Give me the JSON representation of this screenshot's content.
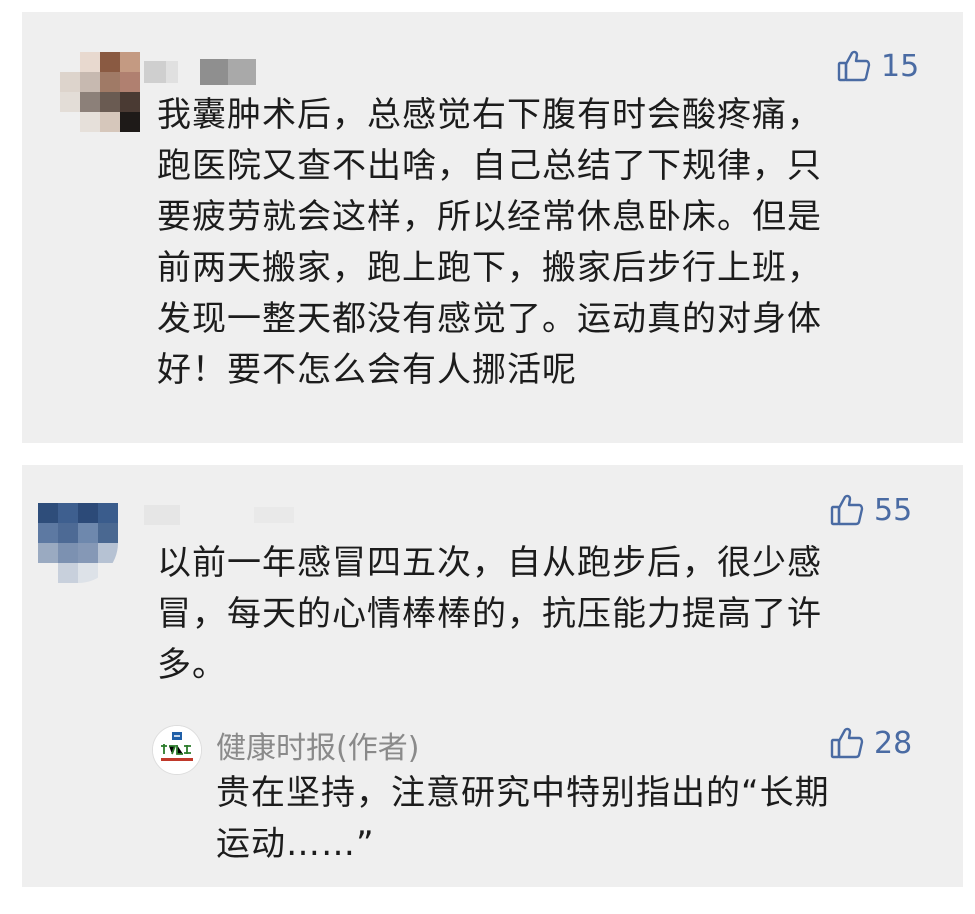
{
  "comments": [
    {
      "likes": "15",
      "lines": [
        "我囊肿术后，总感觉右下腹有时会酸疼痛，",
        "跑医院又查不出啥，自己总结了下规律，只",
        "要疲劳就会这样，所以经常休息卧床。但是",
        "前两天搬家，跑上跑下，搬家后步行上班，",
        "发现一整天都没有感觉了。运动真的对身体",
        "好！要不怎么会有人挪活呢"
      ]
    },
    {
      "likes": "55",
      "lines": [
        "以前一年感冒四五次，自从跑步后，很少感",
        "冒，每天的心情棒棒的，抗压能力提高了许",
        "多。"
      ],
      "reply": {
        "author": "健康时报(作者)",
        "likes": "28",
        "lines": [
          "贵在坚持，注意研究中特别指出的“长期",
          "运动……”"
        ]
      }
    }
  ],
  "colors": {
    "card_bg": "#efefef",
    "like_blue": "#4a6ba3",
    "author_gray": "#8a8a8a"
  },
  "icons": [
    "thumbs-up-icon",
    "avatar-pixelated",
    "health-times-logo-icon"
  ]
}
